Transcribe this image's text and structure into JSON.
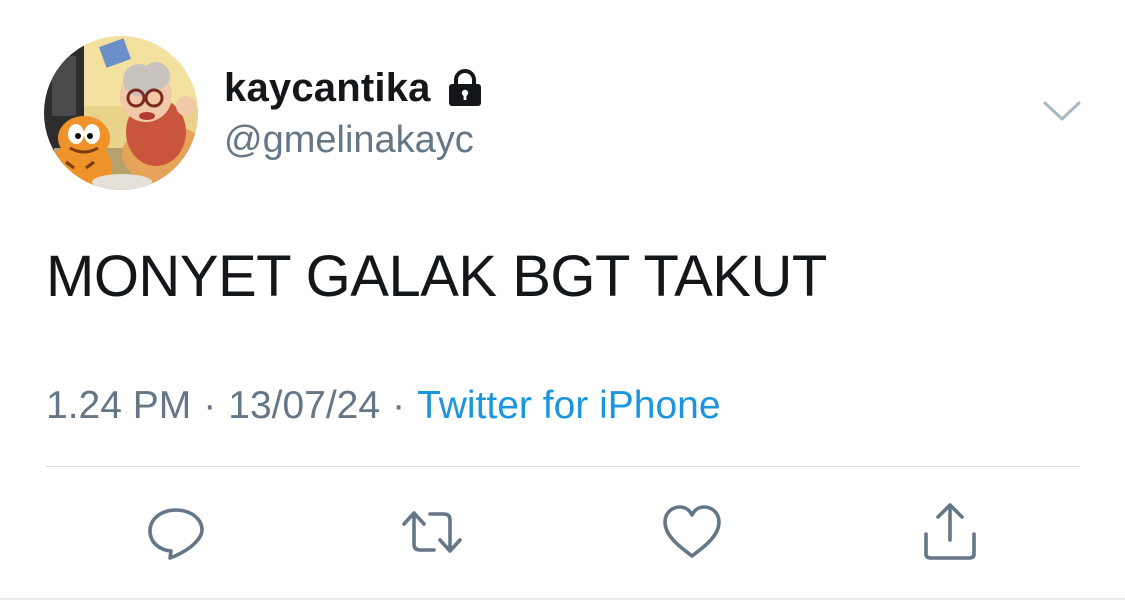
{
  "user": {
    "display_name": "kaycantika",
    "handle": "@gmelinakayc",
    "protected": true,
    "avatar_icon": "garfield-cartoon-avatar",
    "lock_icon": "lock-icon"
  },
  "tweet": {
    "text": "MONYET GALAK BGT TAKUT",
    "time": "1.24 PM",
    "date": "13/07/24",
    "separator": "·",
    "source": "Twitter for iPhone"
  },
  "actions": [
    {
      "name": "reply",
      "icon": "speech-bubble-icon"
    },
    {
      "name": "retweet",
      "icon": "retweet-arrows-icon"
    },
    {
      "name": "like",
      "icon": "heart-icon"
    },
    {
      "name": "share",
      "icon": "share-upload-icon"
    }
  ],
  "colors": {
    "text": "#14171a",
    "secondary": "#657786",
    "link": "#1b95e0",
    "divider": "#d8dde2"
  }
}
